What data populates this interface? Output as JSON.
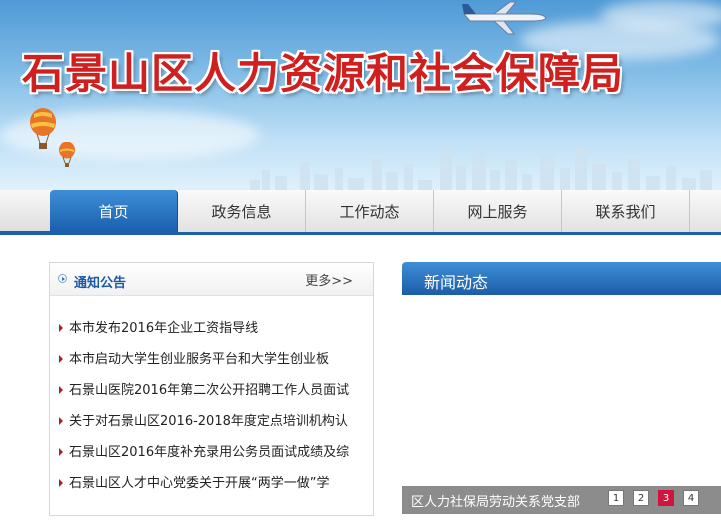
{
  "header": {
    "title": "石景山区人力资源和社会保障局"
  },
  "nav": {
    "items": [
      {
        "label": "首页"
      },
      {
        "label": "政务信息"
      },
      {
        "label": "工作动态"
      },
      {
        "label": "网上服务"
      },
      {
        "label": "联系我们"
      }
    ],
    "active_index": 0
  },
  "notice": {
    "title": "通知公告",
    "more": "更多>>",
    "items": [
      "本市发布2016年企业工资指导线",
      "本市启动大学生创业服务平台和大学生创业板",
      "石景山医院2016年第二次公开招聘工作人员面试",
      "关于对石景山区2016-2018年度定点培训机构认",
      "石景山区2016年度补充录用公务员面试成绩及综",
      "石景山区人才中心党委关于开展“两学一做”学"
    ]
  },
  "news": {
    "title": "新闻动态",
    "caption": "区人力社保局劳动关系党支部",
    "pages": [
      "1",
      "2",
      "3",
      "4"
    ],
    "active_page": "3"
  },
  "colors": {
    "brand_blue": "#1c60ac",
    "title_red": "#cf1f1f",
    "active_page_red": "#d0143d",
    "bullet_red": "#b01e1e"
  },
  "icons": [
    "airplane-icon",
    "hot-air-balloon-icon",
    "circle-arrow-icon",
    "triangle-bullet-icon"
  ]
}
